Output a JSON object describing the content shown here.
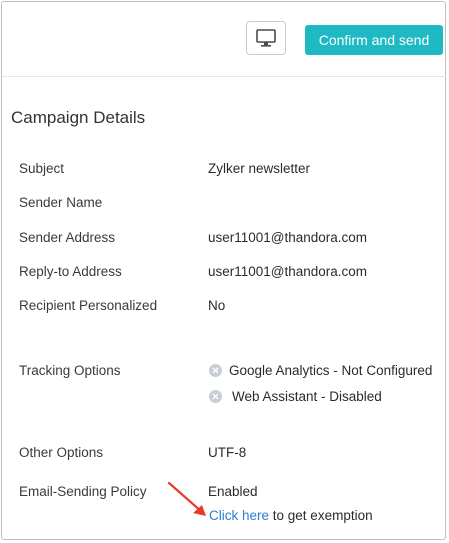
{
  "header": {
    "preview_icon": "desktop-monitor-icon",
    "confirm_label": "Confirm and send"
  },
  "section": {
    "title": "Campaign Details"
  },
  "details": {
    "subject": {
      "label": "Subject",
      "value": "Zylker newsletter"
    },
    "sender_name": {
      "label": "Sender Name",
      "value": ""
    },
    "sender_address": {
      "label": "Sender Address",
      "value": "user11001@thandora.com"
    },
    "reply_to": {
      "label": "Reply-to Address",
      "value": "user11001@thandora.com"
    },
    "personalized": {
      "label": "Recipient Personalized",
      "value": "No"
    },
    "tracking": {
      "label": "Tracking Options",
      "items": [
        {
          "icon": "x-circle-icon",
          "text": "Google Analytics - Not Configured"
        },
        {
          "icon": "x-circle-icon",
          "text": "Web Assistant - Disabled"
        }
      ]
    },
    "other": {
      "label": "Other Options",
      "value": "UTF-8"
    },
    "policy": {
      "label": "Email-Sending Policy",
      "value": "Enabled",
      "link_text": "Click here",
      "link_suffix": " to get exemption"
    }
  },
  "colors": {
    "accent": "#1fb9c4",
    "link": "#2a7fd3",
    "annotation_arrow": "#e8392b"
  }
}
